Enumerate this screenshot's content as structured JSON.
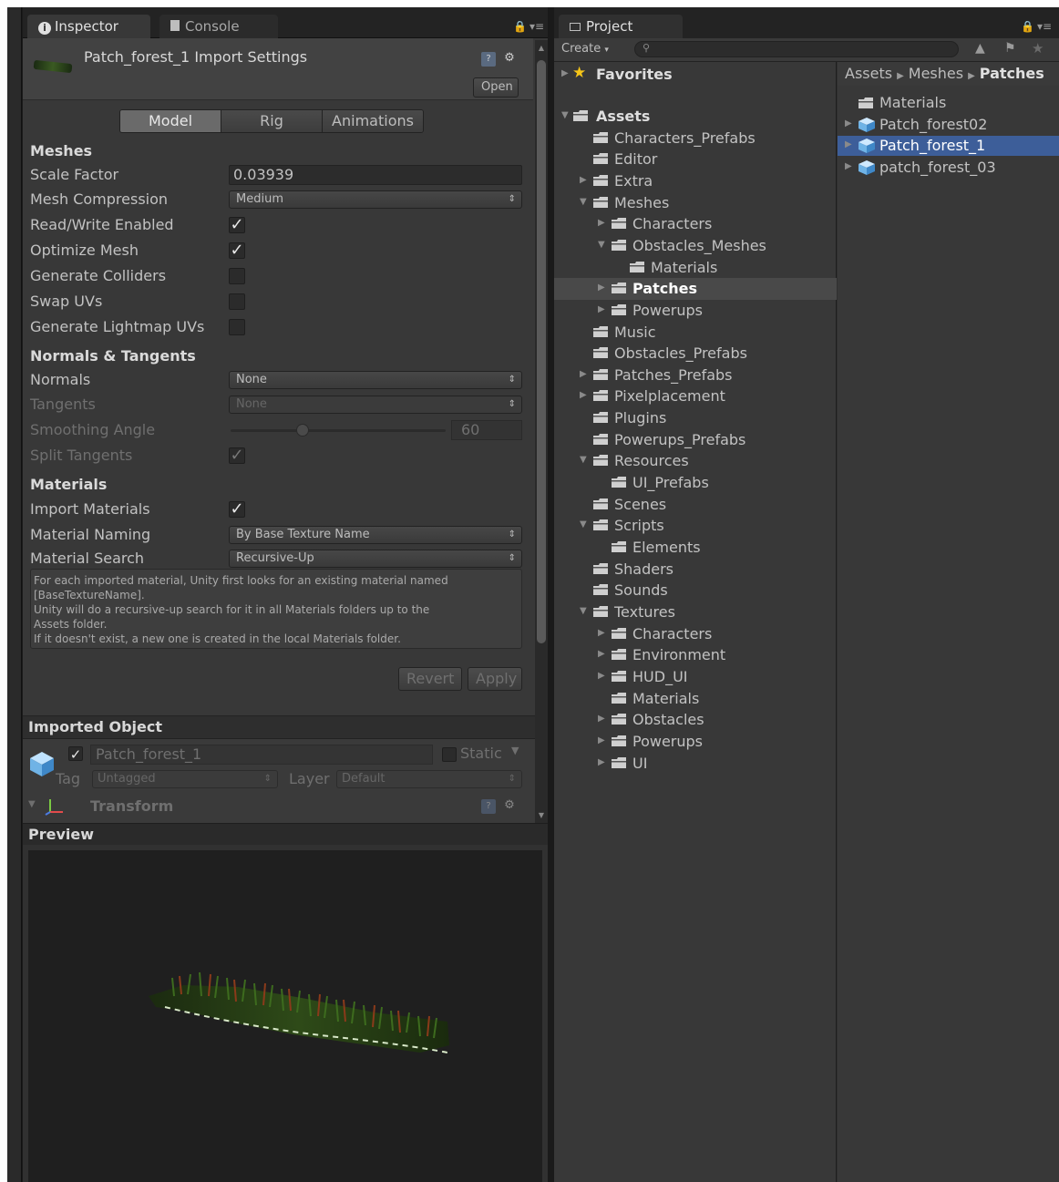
{
  "inspector": {
    "tabs": [
      {
        "label": "Inspector",
        "icon": "info-icon"
      },
      {
        "label": "Console",
        "icon": "console-icon"
      }
    ],
    "header_title": "Patch_forest_1 Import Settings",
    "open_button": "Open",
    "mode_tabs": [
      "Model",
      "Rig",
      "Animations"
    ],
    "active_mode": "Model",
    "meshes": {
      "section_label": "Meshes",
      "scale_factor_label": "Scale Factor",
      "scale_factor_value": "0.03939",
      "mesh_compression_label": "Mesh Compression",
      "mesh_compression_value": "Medium",
      "read_write_label": "Read/Write Enabled",
      "read_write_checked": true,
      "optimize_mesh_label": "Optimize Mesh",
      "optimize_mesh_checked": true,
      "generate_colliders_label": "Generate Colliders",
      "generate_colliders_checked": false,
      "swap_uvs_label": "Swap UVs",
      "swap_uvs_checked": false,
      "lightmap_uvs_label": "Generate Lightmap UVs",
      "lightmap_uvs_checked": false
    },
    "normals": {
      "section_label": "Normals & Tangents",
      "normals_label": "Normals",
      "normals_value": "None",
      "tangents_label": "Tangents",
      "tangents_value": "None",
      "smoothing_label": "Smoothing Angle",
      "smoothing_value": "60",
      "split_tangents_label": "Split Tangents",
      "split_tangents_checked": true
    },
    "materials": {
      "section_label": "Materials",
      "import_label": "Import Materials",
      "import_checked": true,
      "naming_label": "Material Naming",
      "naming_value": "By Base Texture Name",
      "search_label": "Material Search",
      "search_value": "Recursive-Up",
      "help_lines": [
        "For each imported material, Unity first looks for an existing material named",
        "[BaseTextureName].",
        "Unity will do a recursive-up search for it in all Materials folders up to the",
        "Assets folder.",
        "If it doesn't exist, a new one is created in the local Materials folder."
      ]
    },
    "revert_button": "Revert",
    "apply_button": "Apply",
    "imported_object": {
      "header": "Imported Object",
      "name": "Patch_forest_1",
      "active_checked": true,
      "static_label": "Static",
      "tag_label": "Tag",
      "tag_value": "Untagged",
      "layer_label": "Layer",
      "layer_value": "Default",
      "transform_label": "Transform"
    },
    "preview_header": "Preview"
  },
  "project": {
    "tab_label": "Project",
    "create_label": "Create",
    "favorites_label": "Favorites",
    "tree": [
      {
        "label": "Assets",
        "depth": 0,
        "arrow": "open",
        "bold": true
      },
      {
        "label": "Characters_Prefabs",
        "depth": 1,
        "arrow": "none"
      },
      {
        "label": "Editor",
        "depth": 1,
        "arrow": "none"
      },
      {
        "label": "Extra",
        "depth": 1,
        "arrow": "closed"
      },
      {
        "label": "Meshes",
        "depth": 1,
        "arrow": "open"
      },
      {
        "label": "Characters",
        "depth": 2,
        "arrow": "closed"
      },
      {
        "label": "Obstacles_Meshes",
        "depth": 2,
        "arrow": "open"
      },
      {
        "label": "Materials",
        "depth": 3,
        "arrow": "none"
      },
      {
        "label": "Patches",
        "depth": 2,
        "arrow": "closed",
        "selected": true
      },
      {
        "label": "Powerups",
        "depth": 2,
        "arrow": "closed"
      },
      {
        "label": "Music",
        "depth": 1,
        "arrow": "none"
      },
      {
        "label": "Obstacles_Prefabs",
        "depth": 1,
        "arrow": "none"
      },
      {
        "label": "Patches_Prefabs",
        "depth": 1,
        "arrow": "closed"
      },
      {
        "label": "Pixelplacement",
        "depth": 1,
        "arrow": "closed"
      },
      {
        "label": "Plugins",
        "depth": 1,
        "arrow": "none"
      },
      {
        "label": "Powerups_Prefabs",
        "depth": 1,
        "arrow": "none"
      },
      {
        "label": "Resources",
        "depth": 1,
        "arrow": "open"
      },
      {
        "label": "UI_Prefabs",
        "depth": 2,
        "arrow": "none"
      },
      {
        "label": "Scenes",
        "depth": 1,
        "arrow": "none"
      },
      {
        "label": "Scripts",
        "depth": 1,
        "arrow": "open"
      },
      {
        "label": "Elements",
        "depth": 2,
        "arrow": "none"
      },
      {
        "label": "Shaders",
        "depth": 1,
        "arrow": "none"
      },
      {
        "label": "Sounds",
        "depth": 1,
        "arrow": "none"
      },
      {
        "label": "Textures",
        "depth": 1,
        "arrow": "open"
      },
      {
        "label": "Characters",
        "depth": 2,
        "arrow": "closed"
      },
      {
        "label": "Environment",
        "depth": 2,
        "arrow": "closed"
      },
      {
        "label": "HUD_UI",
        "depth": 2,
        "arrow": "closed"
      },
      {
        "label": "Materials",
        "depth": 2,
        "arrow": "none"
      },
      {
        "label": "Obstacles",
        "depth": 2,
        "arrow": "closed"
      },
      {
        "label": "Powerups",
        "depth": 2,
        "arrow": "closed"
      },
      {
        "label": "UI",
        "depth": 2,
        "arrow": "closed"
      }
    ],
    "breadcrumb": [
      "Assets",
      "Meshes",
      "Patches"
    ],
    "files": [
      {
        "label": "Materials",
        "type": "folder"
      },
      {
        "label": "Patch_forest02",
        "type": "model"
      },
      {
        "label": "Patch_forest_1",
        "type": "model",
        "selected": true
      },
      {
        "label": "patch_forest_03",
        "type": "model"
      }
    ]
  },
  "colors": {
    "panel_bg": "#383838",
    "selection_blue": "#3d5e99",
    "folder": "#cfcfcf",
    "cube": "#6fb3e6"
  }
}
